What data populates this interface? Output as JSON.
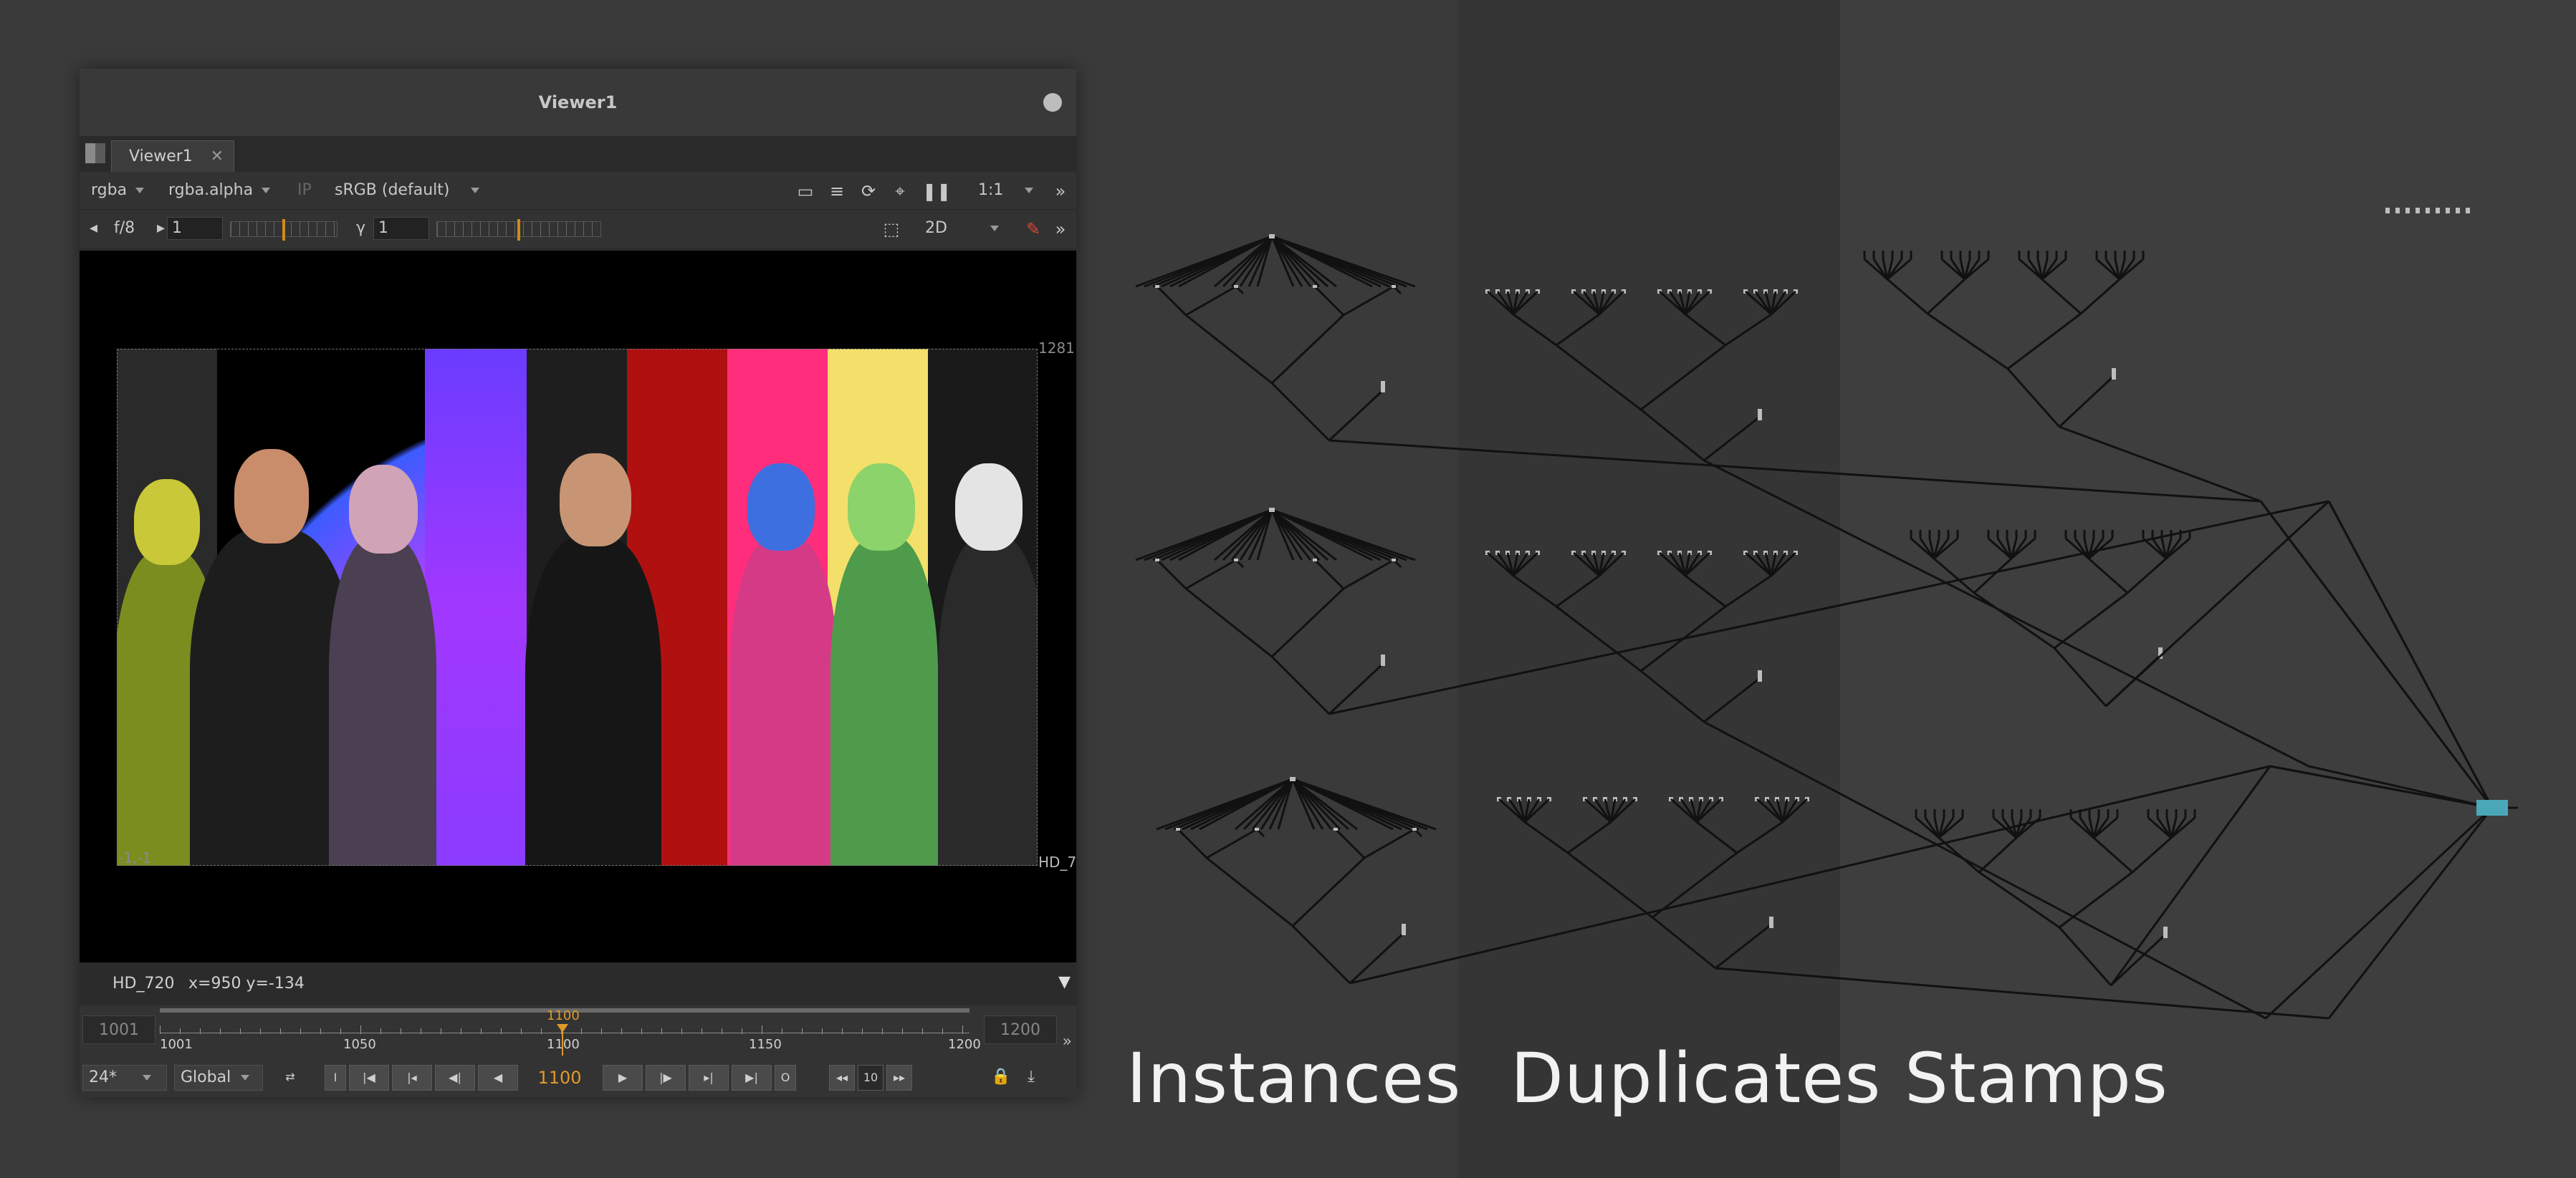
{
  "viewer": {
    "window_title": "Viewer1",
    "tab_label": "Viewer1",
    "toolbar": {
      "channels": "rgba",
      "alpha_channel": "rgba.alpha",
      "ip_label": "IP",
      "colorspace": "sRGB (default)",
      "zoom": "1:1"
    },
    "toolbar2": {
      "fstop": "f/8",
      "gain_value": "1",
      "gamma_label": "γ",
      "gamma_value": "1",
      "view_mode": "2D"
    },
    "image": {
      "format_label_right": "HD_7",
      "top_right_coord": "1281",
      "bottom_left_coord": "-1,-1"
    },
    "info_bar": {
      "format": "HD_720",
      "coords": "x=950 y=-134"
    },
    "timeline": {
      "in_frame": "1001",
      "out_frame": "1200",
      "current_frame_label": "1100",
      "ticks": [
        "1001",
        "1050",
        "1100",
        "1150",
        "1200"
      ]
    },
    "transport": {
      "fps": "24*",
      "scope": "Global",
      "current_frame": "1100",
      "step": "10",
      "in_point_label": "I",
      "out_point_label": "O"
    }
  },
  "sections": {
    "instances": "Instances",
    "duplicates": "Duplicates",
    "stamps": "Stamps"
  },
  "colors": {
    "canvas_bg": "#3a3a3a",
    "duplicates_bg": "#353535",
    "stamps_bg": "#3e3e3e",
    "accent_orange": "#e09a2a",
    "merge_node": "#4aa7b8"
  }
}
